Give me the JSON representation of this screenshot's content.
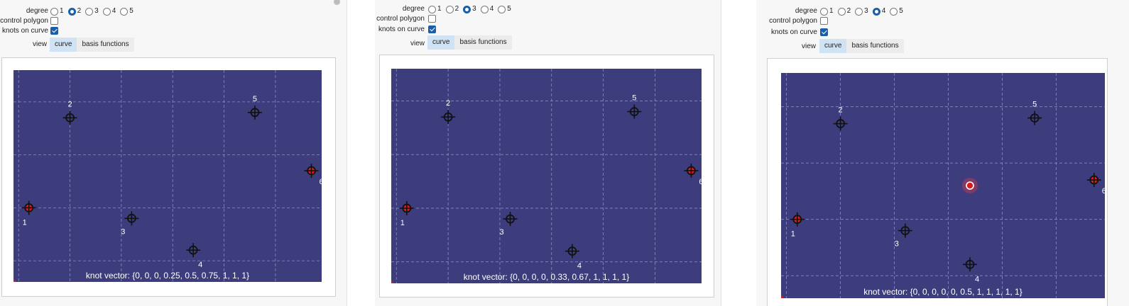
{
  "labels": {
    "degree": "degree",
    "control_polygon": "control polygon",
    "knots_on_curve": "knots on curve",
    "view": "view",
    "view_tabs": [
      "curve",
      "basis functions"
    ],
    "degree_options": [
      "1",
      "2",
      "3",
      "4",
      "5"
    ]
  },
  "colors": {
    "plot_background": "#3d3d7e",
    "grid": "#8c8cc4",
    "curve": "#ffffff",
    "knot": "#d81b1b",
    "selected_radio": "#1a5ea8",
    "active_tab": "#cfe3f5"
  },
  "panels": [
    {
      "selected_degree": "2",
      "control_polygon_checked": false,
      "knots_on_curve_checked": true,
      "active_view": "curve",
      "knot_vector": "knot vector: {0, 0, 0, 0.25, 0.5, 0.75, 1, 1, 1}",
      "control_points": [
        {
          "label": "1",
          "x": 0.3,
          "y": 1.4
        },
        {
          "label": "2",
          "x": 1.1,
          "y": 3.1
        },
        {
          "label": "3",
          "x": 2.3,
          "y": 1.2
        },
        {
          "label": "4",
          "x": 3.5,
          "y": 0.6
        },
        {
          "label": "5",
          "x": 4.7,
          "y": 3.2
        },
        {
          "label": "6",
          "x": 5.8,
          "y": 2.1
        }
      ],
      "knot_parameters": [
        0.25,
        0.5,
        0.75
      ]
    },
    {
      "selected_degree": "3",
      "control_polygon_checked": false,
      "knots_on_curve_checked": true,
      "active_view": "curve",
      "knot_vector": "knot vector: {0, 0, 0, 0, 0.33, 0.67, 1, 1, 1, 1}",
      "control_points": [
        {
          "label": "1",
          "x": 0.3,
          "y": 1.4
        },
        {
          "label": "2",
          "x": 1.1,
          "y": 3.1
        },
        {
          "label": "3",
          "x": 2.3,
          "y": 1.2
        },
        {
          "label": "4",
          "x": 3.5,
          "y": 0.6
        },
        {
          "label": "5",
          "x": 4.7,
          "y": 3.2
        },
        {
          "label": "6",
          "x": 5.8,
          "y": 2.1
        }
      ],
      "knot_parameters": [
        0.33,
        0.67
      ]
    },
    {
      "selected_degree": "4",
      "control_polygon_checked": false,
      "knots_on_curve_checked": true,
      "active_view": "curve",
      "knot_vector": "knot vector: {0, 0, 0, 0, 0, 0.5, 1, 1, 1, 1, 1}",
      "control_points": [
        {
          "label": "1",
          "x": 0.3,
          "y": 1.4
        },
        {
          "label": "2",
          "x": 1.1,
          "y": 3.1
        },
        {
          "label": "3",
          "x": 2.3,
          "y": 1.2
        },
        {
          "label": "4",
          "x": 3.5,
          "y": 0.6
        },
        {
          "label": "5",
          "x": 4.7,
          "y": 3.2
        },
        {
          "label": "6",
          "x": 5.8,
          "y": 2.1
        }
      ],
      "knot_parameters": [
        0.5
      ],
      "highlighted_point": {
        "x": 3.5,
        "y": 2.0
      }
    }
  ]
}
